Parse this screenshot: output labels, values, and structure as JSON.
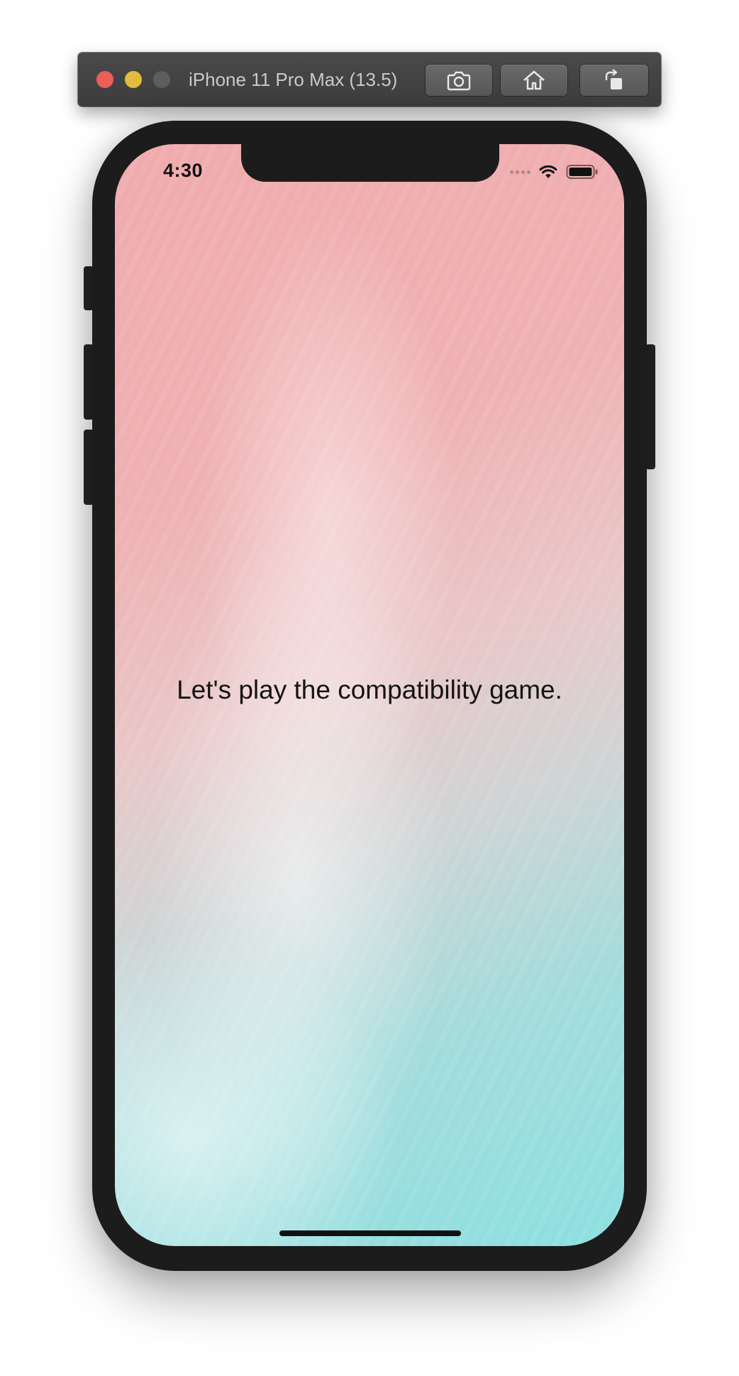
{
  "simulator": {
    "window_title": "iPhone 11 Pro Max (13.5)",
    "toolbar_icons": [
      "screenshot-icon",
      "home-icon",
      "rotate-icon"
    ]
  },
  "status_bar": {
    "time": "4:30",
    "icons": [
      "cellular-signal-icon",
      "wifi-icon",
      "battery-icon"
    ]
  },
  "screen": {
    "headline": "Let's play the compatibility game."
  },
  "colors": {
    "background_top": "#f0a9ab",
    "background_bottom": "#8bdfe0",
    "device_frame": "#1c1c1c",
    "traffic_close": "#ee5d57",
    "traffic_minimize": "#e3bc3d",
    "traffic_zoom": "#5d5d5d"
  }
}
